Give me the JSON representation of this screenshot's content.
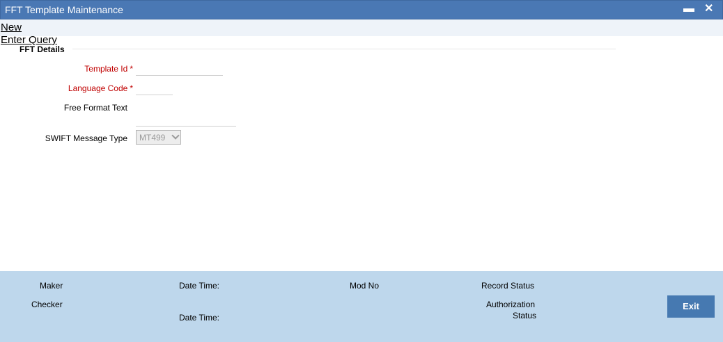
{
  "window": {
    "title": "FFT Template Maintenance",
    "minimize_glyph": "▬",
    "close_glyph": "✕"
  },
  "toolbar": {
    "new_label": "New",
    "enter_query_label": "Enter Query"
  },
  "section": {
    "title": "FFT Details"
  },
  "fields": {
    "template_id": {
      "label": "Template Id",
      "required_mark": "*",
      "value": ""
    },
    "language_code": {
      "label": "Language Code",
      "required_mark": "*",
      "value": ""
    },
    "free_format_text": {
      "label": "Free Format Text",
      "value": ""
    },
    "swift_message_type": {
      "label": "SWIFT Message Type",
      "selected": "MT499"
    }
  },
  "footer": {
    "maker": "Maker",
    "checker": "Checker",
    "date_time_1": "Date Time:",
    "date_time_2": "Date Time:",
    "mod_no": "Mod No",
    "record_status": "Record Status",
    "authorization_line1": "Authorization",
    "authorization_line2": "Status",
    "exit_label": "Exit"
  },
  "colors": {
    "titlebar": "#4a78b4",
    "required": "#c00000",
    "footer": "#bed7ec",
    "exit_button": "#4679b1"
  }
}
